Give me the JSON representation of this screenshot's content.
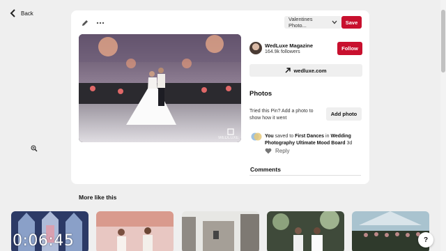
{
  "nav": {
    "back_label": "Back"
  },
  "pin": {
    "board_select": "Valentines Photo...",
    "save_label": "Save",
    "photo_watermark": "WEDLUXE"
  },
  "account": {
    "name": "WedLuxe Magazine",
    "followers": "164.9k followers",
    "follow_label": "Follow"
  },
  "website": {
    "label": "wedluxe.com"
  },
  "photos": {
    "heading": "Photos",
    "prompt": "Tried this Pin? Add a photo to show how it went",
    "add_label": "Add photo"
  },
  "activity": {
    "actor": "You",
    "verb": " saved to ",
    "section": "First Dances",
    "prep": " in ",
    "board": "Wedding Photography Ultimate Mood Board",
    "age": " 3d",
    "reply_label": "Reply"
  },
  "comments": {
    "heading": "Comments"
  },
  "more": {
    "heading": "More like this"
  },
  "overlay": {
    "timer": "0:06:45",
    "help_label": "?"
  },
  "colors": {
    "accent": "#c8102e",
    "background": "#efefef"
  }
}
